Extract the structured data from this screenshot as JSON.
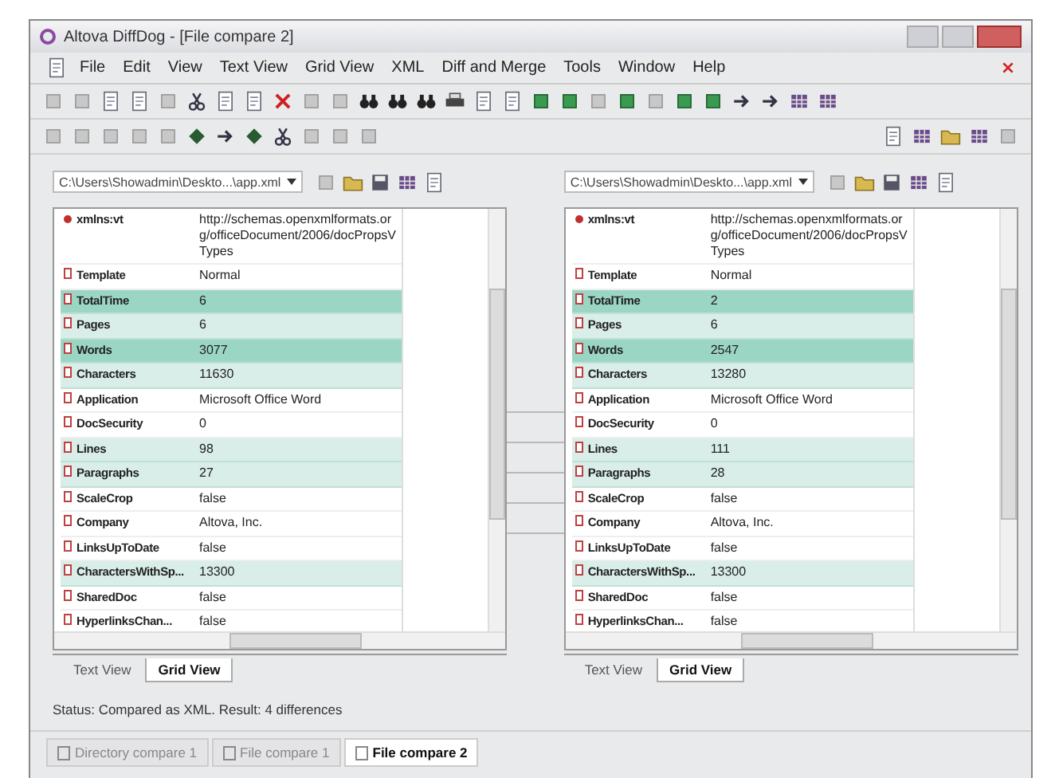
{
  "window": {
    "title": "Altova DiffDog - [File compare 2]"
  },
  "menu": [
    "File",
    "Edit",
    "View",
    "Text View",
    "Grid View",
    "XML",
    "Diff and Merge",
    "Tools",
    "Window",
    "Help"
  ],
  "panes": [
    {
      "path": "C:\\Users\\Showadmin\\Deskto...\\app.xml",
      "rows": [
        {
          "kind": "attribute",
          "name": "xmlns:vt",
          "value": "http://schemas.openxmlformats.org/officeDocument/2006/docPropsVTypes",
          "changed": false,
          "highlighted": false
        },
        {
          "kind": "element",
          "name": "Template",
          "value": "Normal",
          "changed": false,
          "highlighted": false
        },
        {
          "kind": "element",
          "name": "TotalTime",
          "value": "6",
          "changed": true,
          "highlighted": true
        },
        {
          "kind": "element",
          "name": "Pages",
          "value": "6",
          "changed": true,
          "highlighted": false
        },
        {
          "kind": "element",
          "name": "Words",
          "value": "3077",
          "changed": true,
          "highlighted": true
        },
        {
          "kind": "element",
          "name": "Characters",
          "value": "11630",
          "changed": true,
          "highlighted": false
        },
        {
          "kind": "element",
          "name": "Application",
          "value": "Microsoft Office Word",
          "changed": false,
          "highlighted": false
        },
        {
          "kind": "element",
          "name": "DocSecurity",
          "value": "0",
          "changed": false,
          "highlighted": false
        },
        {
          "kind": "element",
          "name": "Lines",
          "value": "98",
          "changed": true,
          "highlighted": false
        },
        {
          "kind": "element",
          "name": "Paragraphs",
          "value": "27",
          "changed": true,
          "highlighted": false
        },
        {
          "kind": "element",
          "name": "ScaleCrop",
          "value": "false",
          "changed": false,
          "highlighted": false
        },
        {
          "kind": "element",
          "name": "Company",
          "value": "Altova, Inc.",
          "changed": false,
          "highlighted": false
        },
        {
          "kind": "element",
          "name": "LinksUpToDate",
          "value": "false",
          "changed": false,
          "highlighted": false
        },
        {
          "kind": "element",
          "name": "CharactersWithSp...",
          "value": "13300",
          "changed": true,
          "highlighted": false
        },
        {
          "kind": "element",
          "name": "SharedDoc",
          "value": "false",
          "changed": false,
          "highlighted": false
        },
        {
          "kind": "element",
          "name": "HyperlinksChan...",
          "value": "false",
          "changed": false,
          "highlighted": false
        }
      ],
      "tabs": [
        {
          "label": "Text View",
          "selected": false
        },
        {
          "label": "Grid View",
          "selected": true
        }
      ]
    },
    {
      "path": "C:\\Users\\Showadmin\\Deskto...\\app.xml",
      "rows": [
        {
          "kind": "attribute",
          "name": "xmlns:vt",
          "value": "http://schemas.openxmlformats.org/officeDocument/2006/docPropsVTypes",
          "changed": false,
          "highlighted": false
        },
        {
          "kind": "element",
          "name": "Template",
          "value": "Normal",
          "changed": false,
          "highlighted": false
        },
        {
          "kind": "element",
          "name": "TotalTime",
          "value": "2",
          "changed": true,
          "highlighted": true
        },
        {
          "kind": "element",
          "name": "Pages",
          "value": "6",
          "changed": true,
          "highlighted": false
        },
        {
          "kind": "element",
          "name": "Words",
          "value": "2547",
          "changed": true,
          "highlighted": true
        },
        {
          "kind": "element",
          "name": "Characters",
          "value": "13280",
          "changed": true,
          "highlighted": false
        },
        {
          "kind": "element",
          "name": "Application",
          "value": "Microsoft Office Word",
          "changed": false,
          "highlighted": false
        },
        {
          "kind": "element",
          "name": "DocSecurity",
          "value": "0",
          "changed": false,
          "highlighted": false
        },
        {
          "kind": "element",
          "name": "Lines",
          "value": "111",
          "changed": true,
          "highlighted": false
        },
        {
          "kind": "element",
          "name": "Paragraphs",
          "value": "28",
          "changed": true,
          "highlighted": false
        },
        {
          "kind": "element",
          "name": "ScaleCrop",
          "value": "false",
          "changed": false,
          "highlighted": false
        },
        {
          "kind": "element",
          "name": "Company",
          "value": "Altova, Inc.",
          "changed": false,
          "highlighted": false
        },
        {
          "kind": "element",
          "name": "LinksUpToDate",
          "value": "false",
          "changed": false,
          "highlighted": false
        },
        {
          "kind": "element",
          "name": "CharactersWithSp...",
          "value": "13300",
          "changed": true,
          "highlighted": false
        },
        {
          "kind": "element",
          "name": "SharedDoc",
          "value": "false",
          "changed": false,
          "highlighted": false
        },
        {
          "kind": "element",
          "name": "HyperlinksChan...",
          "value": "false",
          "changed": false,
          "highlighted": false
        }
      ],
      "tabs": [
        {
          "label": "Text View",
          "selected": false
        },
        {
          "label": "Grid View",
          "selected": true
        }
      ]
    }
  ],
  "status_bar": "Status: Compared as XML. Result: 4 differences",
  "documents": [
    {
      "label": "Directory compare 1",
      "selected": false
    },
    {
      "label": "File compare 1",
      "selected": false
    },
    {
      "label": "File compare 2",
      "selected": true
    }
  ]
}
